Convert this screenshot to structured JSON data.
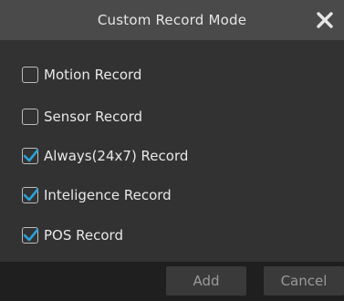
{
  "dialog": {
    "title": "Custom Record Mode",
    "close_icon": "close-icon"
  },
  "options": [
    {
      "label": "Motion Record",
      "checked": false
    },
    {
      "label": "Sensor Record",
      "checked": false
    },
    {
      "label": "Always(24x7) Record",
      "checked": true
    },
    {
      "label": "Inteligence Record",
      "checked": true
    },
    {
      "label": "POS Record",
      "checked": true
    }
  ],
  "footer": {
    "add_label": "Add",
    "cancel_label": "Cancel"
  },
  "colors": {
    "check_accent": "#2ba3d8",
    "titlebar": "#4a4a4a",
    "body": "#323232",
    "footer": "#1f1f1f"
  }
}
